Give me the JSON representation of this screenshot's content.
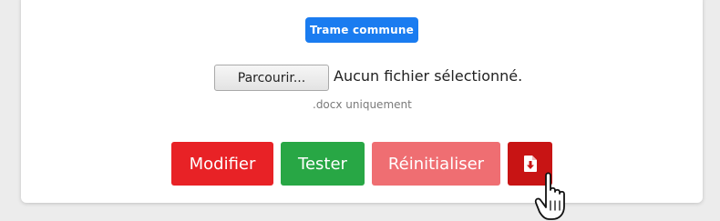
{
  "template_badge": {
    "label": "Trame commune"
  },
  "file_input": {
    "button_label": "Parcourir...",
    "status_text": "Aucun fichier sélectionné.",
    "hint": ".docx uniquement"
  },
  "actions": {
    "modify_label": "Modifier",
    "test_label": "Tester",
    "reset_label": "Réinitialiser",
    "download_icon": "file-download-icon"
  },
  "colors": {
    "badge": "#1a7cf0",
    "modify": "#e82226",
    "test": "#28a745",
    "reset": "#ef6e72",
    "download": "#c81414",
    "background": "#ececec",
    "card": "#ffffff"
  }
}
